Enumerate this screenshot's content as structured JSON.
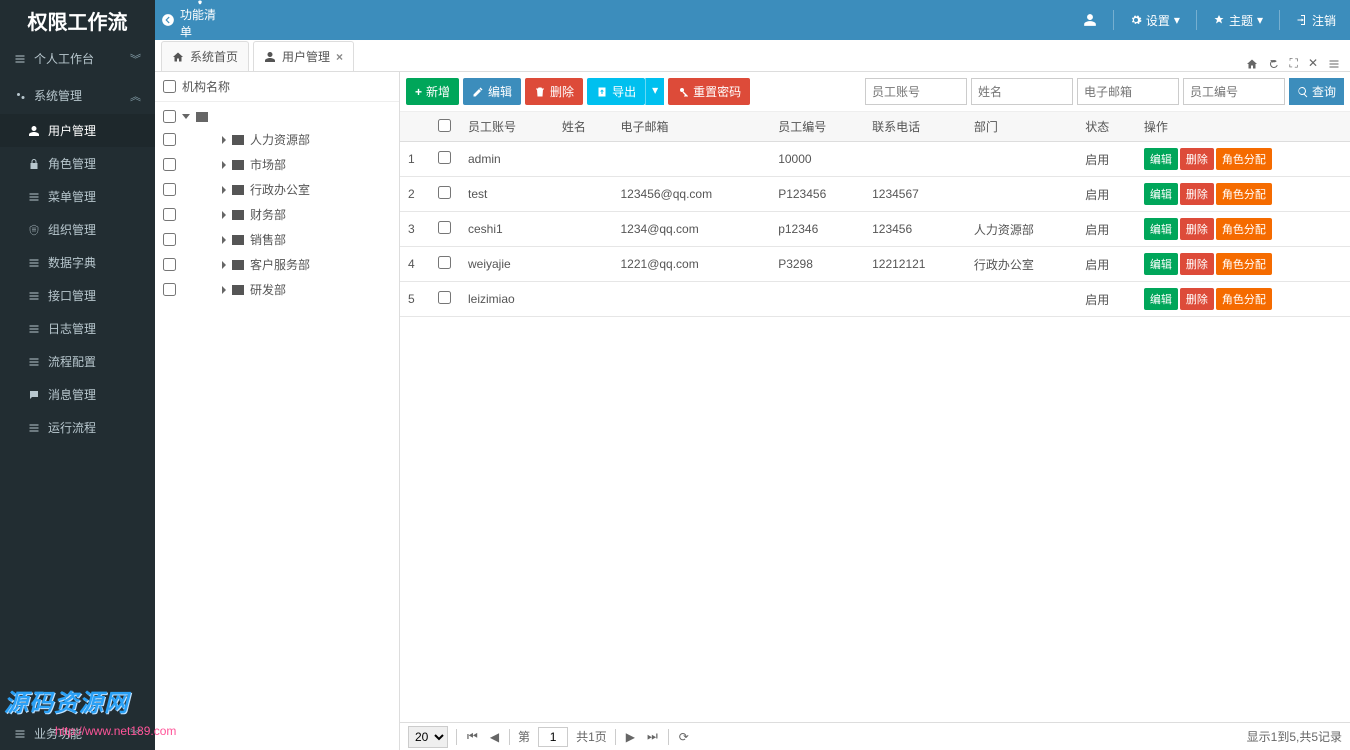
{
  "app": {
    "title": "权限工作流"
  },
  "topmenu": {
    "label": "功能清单"
  },
  "topright": {
    "settings": "设置",
    "theme": "主题",
    "logout": "注销"
  },
  "sidebar": {
    "group1": {
      "label": "个人工作台"
    },
    "group2": {
      "label": "系统管理"
    },
    "items": [
      {
        "label": "用户管理"
      },
      {
        "label": "角色管理"
      },
      {
        "label": "菜单管理"
      },
      {
        "label": "组织管理"
      },
      {
        "label": "数据字典"
      },
      {
        "label": "接口管理"
      },
      {
        "label": "日志管理"
      },
      {
        "label": "流程配置"
      },
      {
        "label": "消息管理"
      },
      {
        "label": "运行流程"
      }
    ],
    "bottom": {
      "label": "业务功能"
    }
  },
  "tabs": {
    "home": "系统首页",
    "current": "用户管理"
  },
  "tree": {
    "header": "机构名称",
    "nodes": [
      {
        "label": "人力资源部"
      },
      {
        "label": "市场部"
      },
      {
        "label": "行政办公室"
      },
      {
        "label": "财务部"
      },
      {
        "label": "销售部"
      },
      {
        "label": "客户服务部"
      },
      {
        "label": "研发部"
      }
    ]
  },
  "toolbar": {
    "add": "新增",
    "edit": "编辑",
    "delete": "删除",
    "export": "导出",
    "resetpwd": "重置密码"
  },
  "filters": {
    "p1": "员工账号",
    "p2": "姓名",
    "p3": "电子邮箱",
    "p4": "员工编号",
    "search": "查询"
  },
  "columns": {
    "account": "员工账号",
    "name": "姓名",
    "email": "电子邮箱",
    "empno": "员工编号",
    "phone": "联系电话",
    "dept": "部门",
    "status": "状态",
    "ops": "操作"
  },
  "rows": [
    {
      "idx": "1",
      "account": "admin",
      "name": "",
      "email": "",
      "empno": "10000",
      "phone": "",
      "dept": "",
      "status": "启用"
    },
    {
      "idx": "2",
      "account": "test",
      "name": "",
      "email": "123456@qq.com",
      "empno": "P123456",
      "phone": "1234567",
      "dept": "",
      "status": "启用"
    },
    {
      "idx": "3",
      "account": "ceshi1",
      "name": "",
      "email": "1234@qq.com",
      "empno": "p12346",
      "phone": "123456",
      "dept": "人力资源部",
      "status": "启用"
    },
    {
      "idx": "4",
      "account": "weiyajie",
      "name": "",
      "email": "1221@qq.com",
      "empno": "P3298",
      "phone": "12212121",
      "dept": "行政办公室",
      "status": "启用"
    },
    {
      "idx": "5",
      "account": "leizimiao",
      "name": "",
      "email": "",
      "empno": "",
      "phone": "",
      "dept": "",
      "status": "启用"
    }
  ],
  "rowops": {
    "edit": "编辑",
    "delete": "删除",
    "role": "角色分配"
  },
  "pager": {
    "size": "20",
    "pagelbl": "第",
    "page": "1",
    "totalpages": "共1页",
    "summary": "显示1到5,共5记录"
  },
  "watermark": {
    "text": "源码资源网",
    "url": "http://www.net189.com"
  }
}
